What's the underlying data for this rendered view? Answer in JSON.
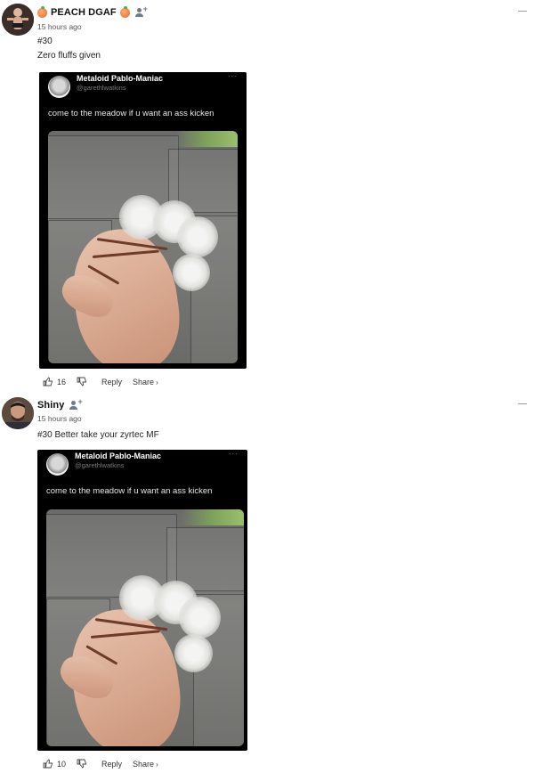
{
  "comments": [
    {
      "username": "PEACH DGAF",
      "time": "15 hours ago",
      "lines": [
        "#30",
        "Zero fluffs given"
      ],
      "likes": "16",
      "reply_label": "Reply",
      "share_label": "Share",
      "share_chevron": "›",
      "collapse_label": "−",
      "tweet": {
        "name": "Metaloid Pablo-Maniac",
        "handle": "@garethlwatkins",
        "text": "come to the meadow if u want an ass kicken",
        "dots": "···"
      }
    },
    {
      "username": "Shiny",
      "time": "15 hours ago",
      "lines": [
        "#30 Better take your zyrtec MF"
      ],
      "likes": "10",
      "reply_label": "Reply",
      "share_label": "Share",
      "share_chevron": "›",
      "collapse_label": "−",
      "tweet": {
        "name": "Metaloid Pablo-Maniac",
        "handle": "@garethlwatkins",
        "text": "come to the meadow if u want an ass kicken",
        "dots": "···"
      }
    }
  ],
  "colors": {
    "tweet_bg": "#000000",
    "follow_icon": "#6d7b8a",
    "peach_emoji": "#f07a3e"
  },
  "icons": {
    "follow": "person-plus-icon",
    "like": "thumbs-up-icon",
    "dislike": "thumbs-down-icon",
    "peach": "peach-emoji-icon"
  }
}
